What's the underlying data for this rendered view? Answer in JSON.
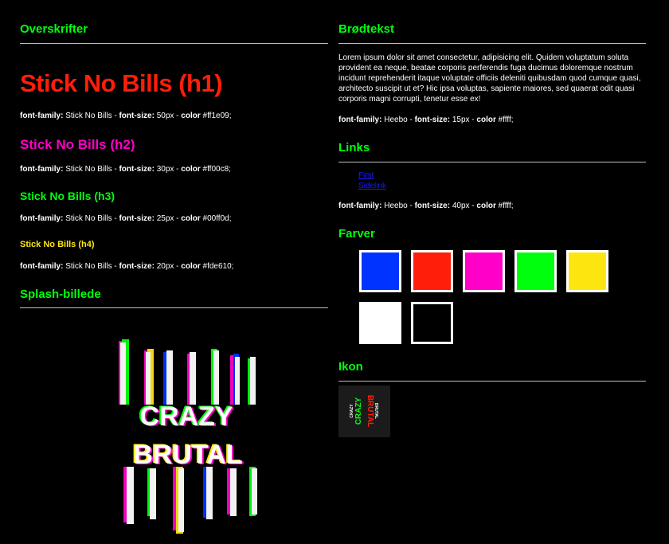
{
  "left": {
    "headings_title": "Overskrifter",
    "h1": {
      "text": "Stick No Bills (h1)",
      "spec": {
        "ff_label": "font-family:",
        "ff_value": " Stick No Bills - ",
        "fs_label": "font-size:",
        "fs_value": " 50px - ",
        "color_label": "color",
        "color_value": " #ff1e09;"
      }
    },
    "h2": {
      "text": "Stick No Bills (h2)",
      "spec": {
        "ff_label": "font-family:",
        "ff_value": " Stick No Bills - ",
        "fs_label": "font-size:",
        "fs_value": " 30px - ",
        "color_label": "color",
        "color_value": " #ff00c8;"
      }
    },
    "h3": {
      "text": "Stick No Bills (h3)",
      "spec": {
        "ff_label": "font-family:",
        "ff_value": " Stick No Bills - ",
        "fs_label": "font-size:",
        "fs_value": " 25px - ",
        "color_label": "color",
        "color_value": " #00ff0d;"
      }
    },
    "h4": {
      "text": "Stick No Bills (h4)",
      "spec": {
        "ff_label": "font-family:",
        "ff_value": " Stick No Bills - ",
        "fs_label": "font-size:",
        "fs_value": " 20px - ",
        "color_label": "color",
        "color_value": " #fde610;"
      }
    },
    "splash_title": "Splash-billede",
    "splash_words": [
      "CRAZY",
      "BRUTAL"
    ]
  },
  "right": {
    "body_title": "Brødtekst",
    "body_text": "Lorem ipsum dolor sit amet consectetur, adipisicing elit. Quidem voluptatum soluta provident ea neque, beatae corporis perferendis fuga ducimus doloremque nostrum incidunt reprehenderit itaque voluptate officiis deleniti quibusdam quod cumque quasi, architecto suscipit ut et? Hic ipsa voluptas, sapiente maiores, sed quaerat odit quasi corporis magni corrupti, tenetur esse ex!",
    "body_spec": {
      "ff_label": "font-family:",
      "ff_value": " Heebo - ",
      "fs_label": "font-size:",
      "fs_value": " 15px - ",
      "color_label": "color",
      "color_value": " #ffff;"
    },
    "links_title": "Links",
    "links": [
      "First",
      "Sidelink"
    ],
    "links_spec": {
      "ff_label": "font-family:",
      "ff_value": " Heebo - ",
      "fs_label": "font-size:",
      "fs_value": " 40px - ",
      "color_label": "color",
      "color_value": " #ffff;"
    },
    "colors_title": "Farver",
    "colors": [
      "#0033ff",
      "#ff1e09",
      "#ff00c8",
      "#00ff0d",
      "#fde610",
      "#ffffff",
      "#000000"
    ],
    "icon_title": "Ikon",
    "icon_words": [
      "CRAZY",
      "CRAZY",
      "BRUTAL",
      "BRUTAL"
    ]
  }
}
